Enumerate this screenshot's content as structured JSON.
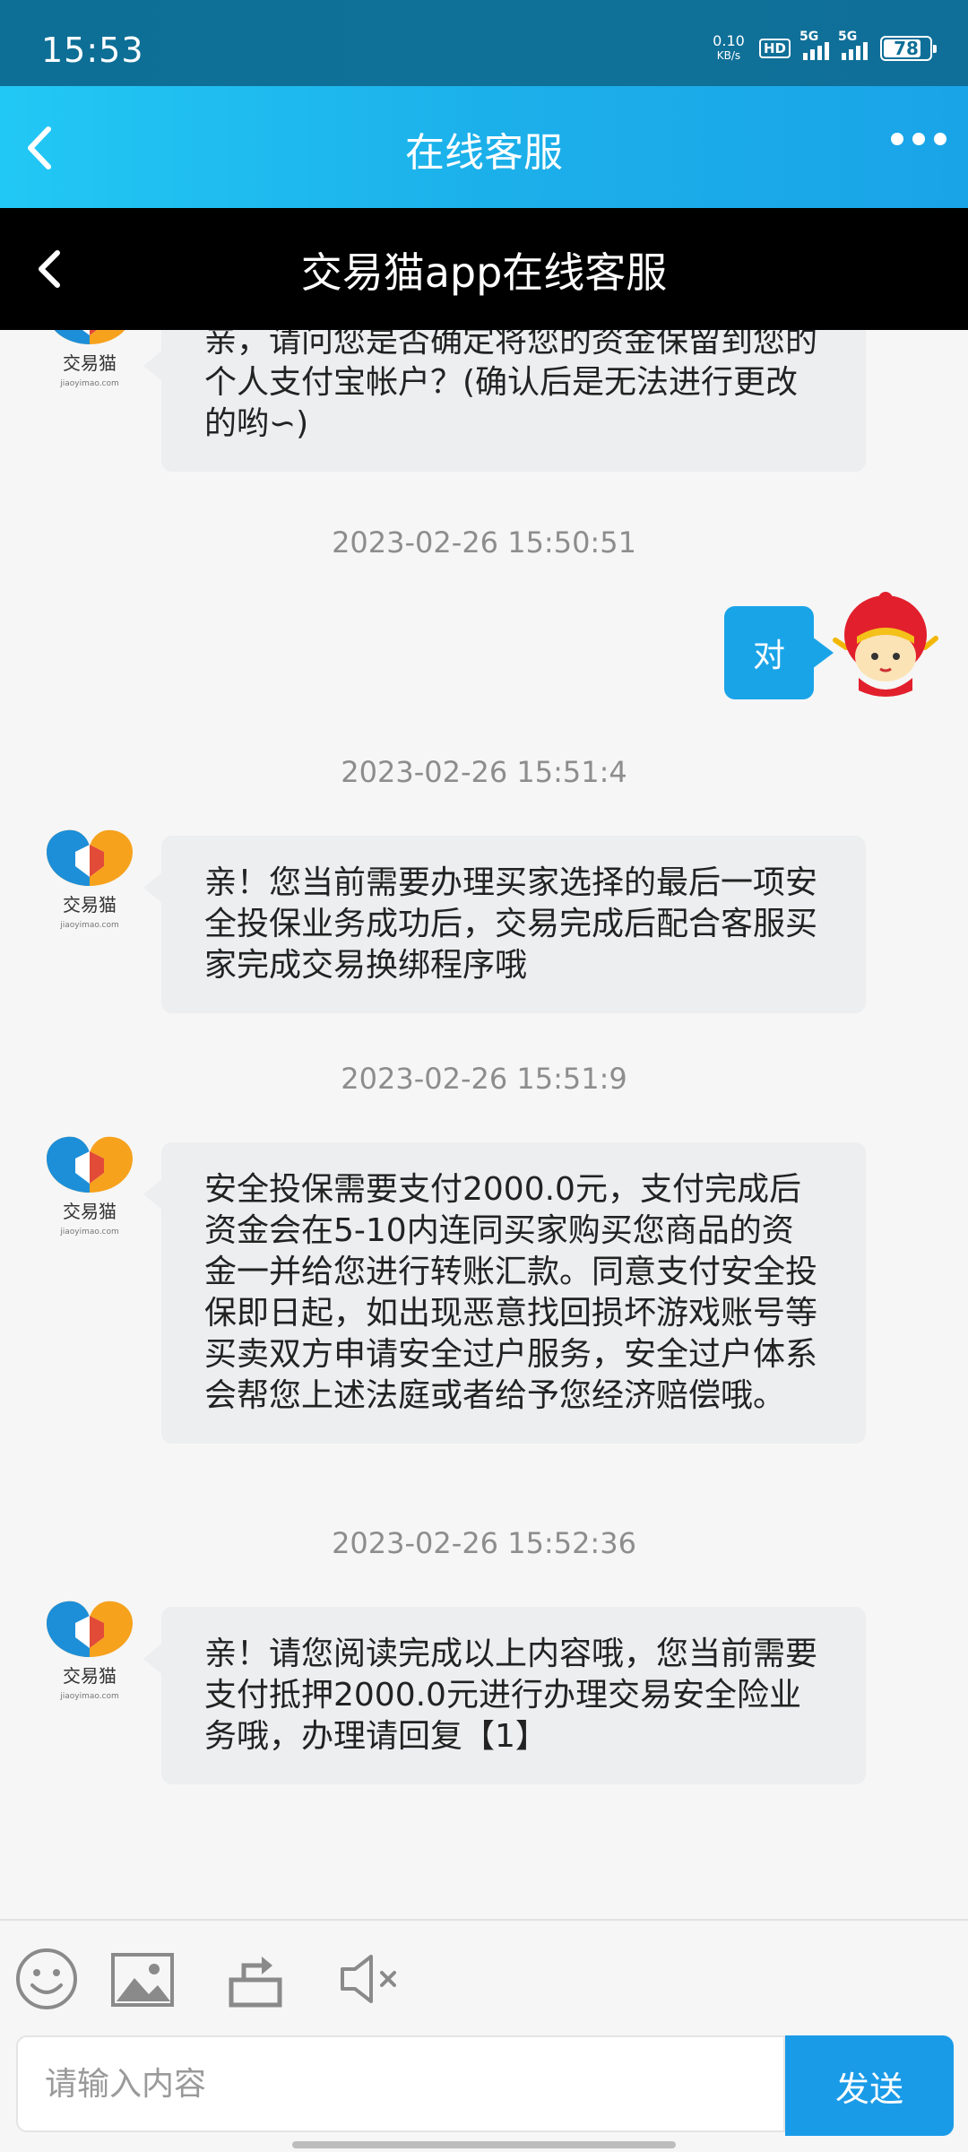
{
  "status": {
    "time": "15:53",
    "net_speed": "0.10",
    "net_unit": "KB/s",
    "hd": "HD",
    "sig1": "5G",
    "sig2": "5G",
    "battery": "78"
  },
  "header": {
    "title": "在线客服"
  },
  "subheader": {
    "title": "交易猫app在线客服"
  },
  "brand": {
    "logo_text": "交易猫",
    "logo_sub": "jiaoyimao.com"
  },
  "messages": [
    {
      "text": "亲，请问您是否确定将您的资金保留到您的个人支付宝帐户？(确认后是无法进行更改的哟∽)"
    },
    {
      "timestamp": "2023-02-26 15:50:51"
    },
    {
      "user_text": "对"
    },
    {
      "timestamp": "2023-02-26 15:51:4"
    },
    {
      "text": "亲！您当前需要办理买家选择的最后一项安全投保业务成功后，交易完成后配合客服买家完成交易换绑程序哦"
    },
    {
      "timestamp": "2023-02-26 15:51:9"
    },
    {
      "text": "安全投保需要支付2000.0元，支付完成后资金会在5-10内连同买家购买您商品的资金一并给您进行转账汇款。同意支付安全投保即日起，如出现恶意找回损坏游戏账号等买卖双方申请安全过户服务，安全过户体系会帮您上述法庭或者给予您经济赔偿哦。"
    },
    {
      "timestamp": "2023-02-26 15:52:36"
    },
    {
      "text": "亲！请您阅读完成以上内容哦，您当前需要支付抵押2000.0元进行办理交易安全险业务哦，办理请回复【1】"
    }
  ],
  "composer": {
    "placeholder": "请输入内容",
    "send_label": "发送"
  },
  "colors": {
    "accent": "#1aa4e8",
    "header_dark": "#000000",
    "bubble": "#eceeef"
  }
}
